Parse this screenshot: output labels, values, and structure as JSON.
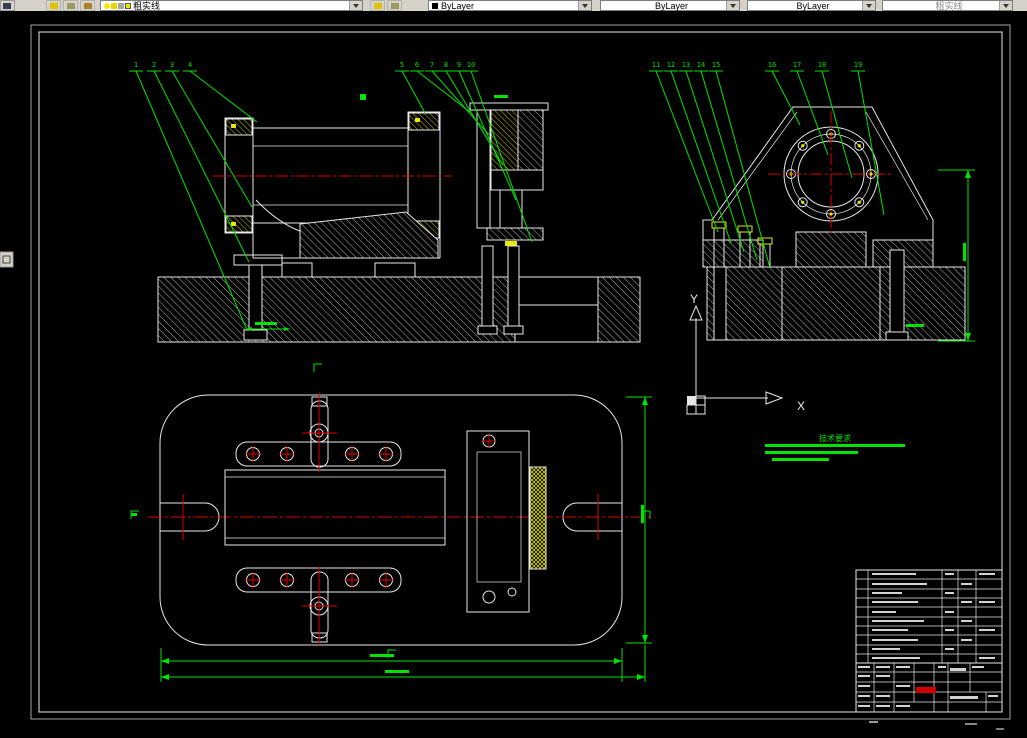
{
  "toolbar": {
    "layer_control": "粗实线",
    "color_control": "ByLayer",
    "linetype_control": "ByLayer",
    "lineweight_control": "ByLayer",
    "plot_style_control": "粗实线"
  },
  "ucs": {
    "x_label": "X",
    "y_label": "Y"
  },
  "notes": {
    "heading": "技术要求"
  },
  "callouts": [
    "1",
    "2",
    "3",
    "4",
    "5",
    "6",
    "7",
    "8",
    "9",
    "10",
    "11",
    "12",
    "13",
    "14",
    "15",
    "16",
    "17",
    "18",
    "19"
  ],
  "colors": {
    "background": "#000000",
    "lines": "#e8e8e8",
    "dimensions": "#00e400",
    "centerlines": "#dd0000",
    "details": "#e8e800",
    "toolbar_bg": "#d6d2c9"
  }
}
